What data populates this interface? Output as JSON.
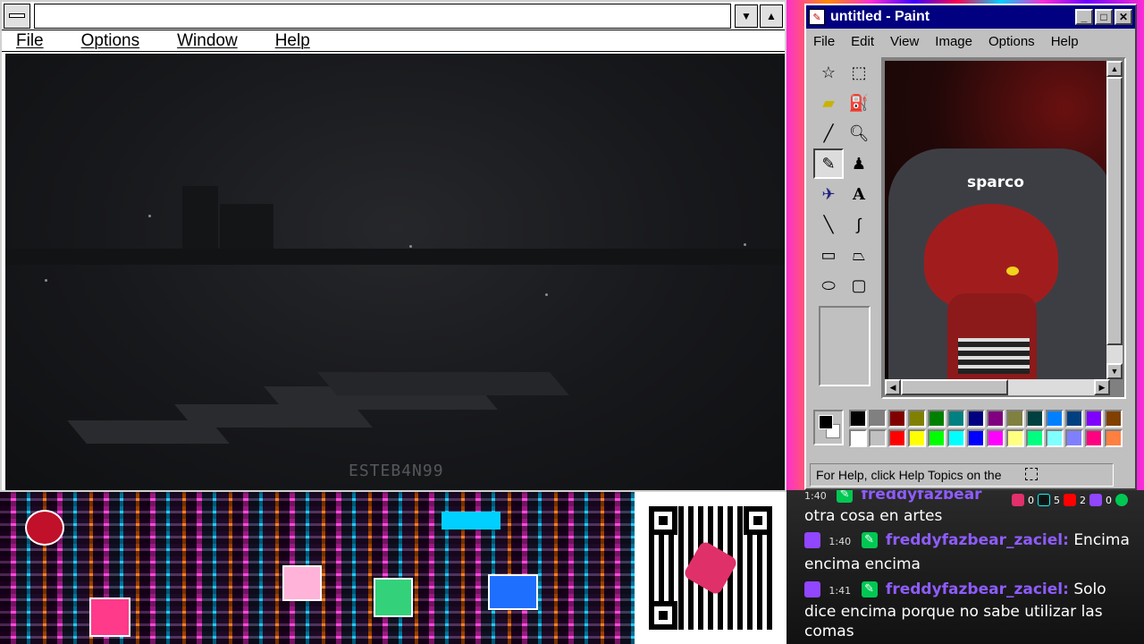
{
  "win31": {
    "menus": [
      {
        "label": "File"
      },
      {
        "label": "Options"
      },
      {
        "label": "Window"
      },
      {
        "label": "Help"
      }
    ],
    "watermark": "ESTEB4N99"
  },
  "paint": {
    "title": "untitled - Paint",
    "menus": [
      {
        "label": "File"
      },
      {
        "label": "Edit"
      },
      {
        "label": "View"
      },
      {
        "label": "Image"
      },
      {
        "label": "Options"
      },
      {
        "label": "Help"
      }
    ],
    "tools": [
      "free-select-icon",
      "rect-select-icon",
      "eraser-icon",
      "fill-icon",
      "eyedropper-icon",
      "magnifier-icon",
      "pencil-icon",
      "brush-icon",
      "airbrush-icon",
      "text-icon",
      "line-icon",
      "curve-icon",
      "rectangle-icon",
      "polygon-icon",
      "ellipse-icon",
      "rounded-rect-icon"
    ],
    "canvas_chair_logo": "sparco",
    "status": "For Help, click Help Topics on the",
    "palette": [
      "#000000",
      "#808080",
      "#800000",
      "#808000",
      "#008000",
      "#008080",
      "#000080",
      "#800080",
      "#808040",
      "#004040",
      "#0080ff",
      "#004080",
      "#8000ff",
      "#804000",
      "#ffffff",
      "#c0c0c0",
      "#ff0000",
      "#ffff00",
      "#00ff00",
      "#00ffff",
      "#0000ff",
      "#ff00ff",
      "#ffff80",
      "#00ff80",
      "#80ffff",
      "#8080ff",
      "#ff0080",
      "#ff8040"
    ]
  },
  "chat": {
    "messages": [
      {
        "time": "1:40",
        "user": "freddyfazbear",
        "text": ""
      },
      {
        "time": "",
        "user": "",
        "text": "otra cosa en artes"
      },
      {
        "time": "1:40",
        "user": "freddyfazbear_zaciel:",
        "text": "Encima"
      },
      {
        "time": "",
        "user": "",
        "text": "encima encima"
      },
      {
        "time": "1:41",
        "user": "freddyfazbear_zaciel:",
        "text": "Solo"
      },
      {
        "time": "",
        "user": "",
        "text": "dice encima porque no sabe utilizar las"
      },
      {
        "time": "",
        "user": "",
        "text": "comas"
      }
    ],
    "social_counts": [
      "0",
      "5",
      "2",
      "0"
    ]
  }
}
